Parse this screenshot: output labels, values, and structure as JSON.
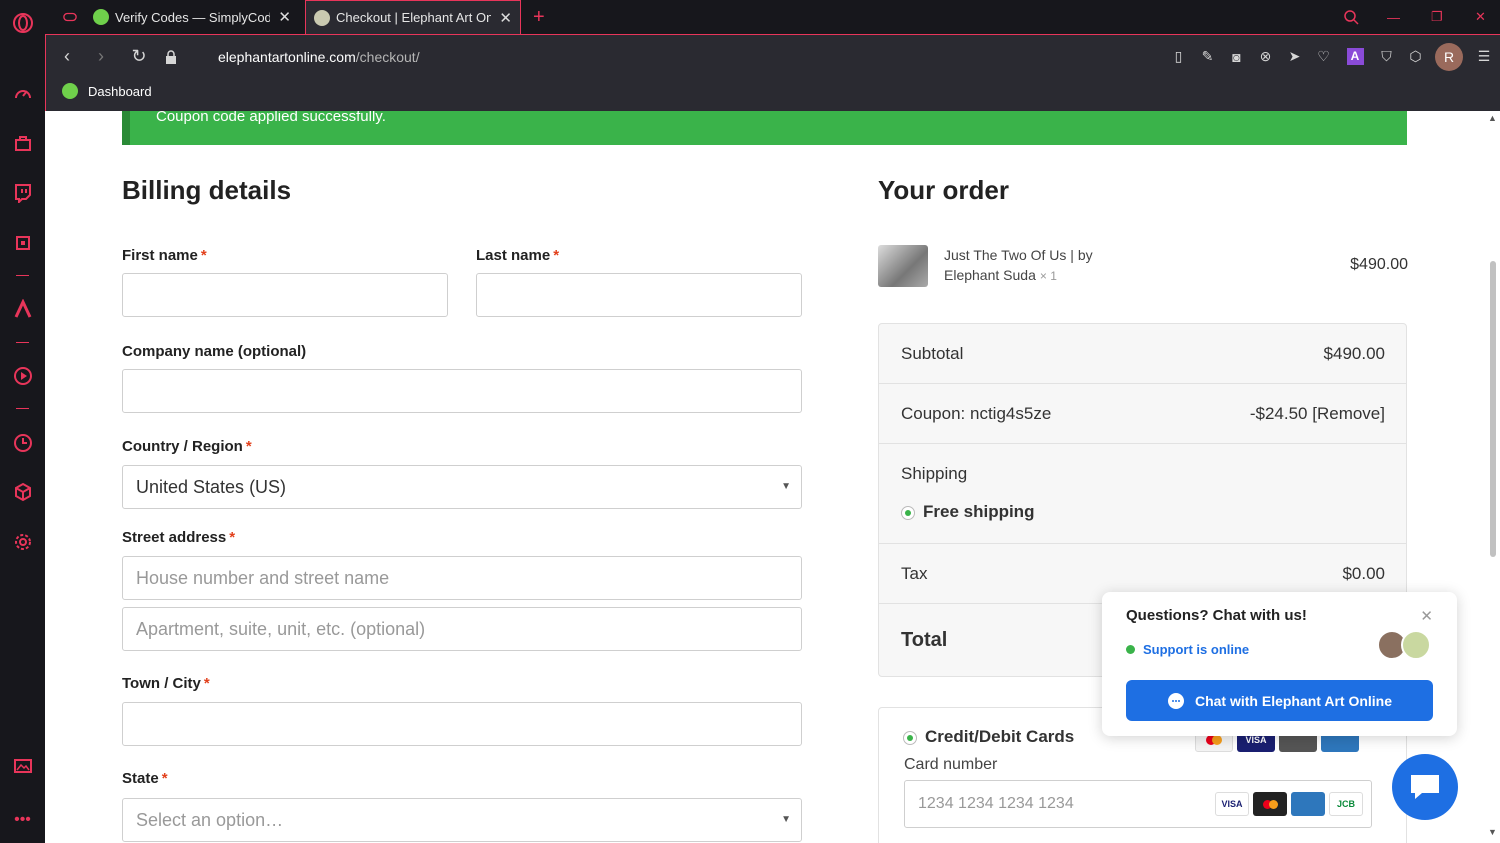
{
  "browser": {
    "tabs": [
      {
        "title": "Verify Codes — SimplyCodes",
        "active": false
      },
      {
        "title": "Checkout | Elephant Art Online",
        "active": true
      }
    ],
    "url_host": "elephantartonline.com",
    "url_path": "/checkout/",
    "bookmark_label": "Dashboard",
    "profile_initial": "R",
    "accent_color": "#e8355a"
  },
  "notice": "Coupon code applied successfully.",
  "billing": {
    "title": "Billing details",
    "first_name_label": "First name",
    "last_name_label": "Last name",
    "company_label": "Company name (optional)",
    "country_label": "Country / Region",
    "country_value": "United States (US)",
    "street_label": "Street address",
    "street_placeholder_1": "House number and street name",
    "street_placeholder_2": "Apartment, suite, unit, etc. (optional)",
    "city_label": "Town / City",
    "state_label": "State",
    "state_placeholder": "Select an option…",
    "required_mark": "*"
  },
  "order": {
    "title": "Your order",
    "product_name": "Just The Two Of Us | by Elephant Suda",
    "product_qty": "× 1",
    "product_price": "$490.00",
    "subtotal_label": "Subtotal",
    "subtotal_value": "$490.00",
    "coupon_label": "Coupon: nctig4s5ze",
    "coupon_value": "-$24.50 [Remove]",
    "shipping_label": "Shipping",
    "shipping_option": "Free shipping",
    "tax_label": "Tax",
    "tax_value": "$0.00",
    "total_label": "Total"
  },
  "payment": {
    "method_label": "Credit/Debit Cards",
    "card_number_label": "Card number",
    "card_number_placeholder": "1234 1234 1234 1234",
    "card_brands": [
      "VISA",
      "MC",
      "AMEX",
      "JCB"
    ]
  },
  "chat": {
    "question": "Questions? Chat with us!",
    "status": "Support is online",
    "button_label": "Chat with Elephant Art Online",
    "brand_color": "#1e6fe3"
  }
}
